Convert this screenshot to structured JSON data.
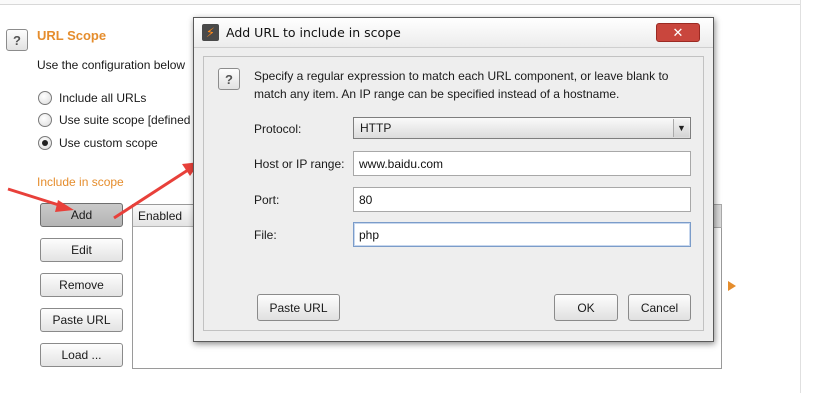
{
  "background": {
    "section_title": "URL Scope",
    "description": "Use the configuration below",
    "radio_options": [
      {
        "label": "Include all URLs",
        "checked": false
      },
      {
        "label": "Use suite scope [defined",
        "checked": false
      },
      {
        "label": "Use custom scope",
        "checked": true
      }
    ],
    "include_label": "Include in scope",
    "buttons": {
      "add": "Add",
      "edit": "Edit",
      "remove": "Remove",
      "paste_url": "Paste URL",
      "load": "Load ..."
    },
    "table": {
      "columns": [
        "Enabled"
      ]
    }
  },
  "dialog": {
    "title": "Add URL to include in scope",
    "close_glyph": "✕",
    "instruction": "Specify a regular expression to match each URL component, or leave blank to match any item. An IP range can be specified instead of a hostname.",
    "fields": {
      "protocol_label": "Protocol:",
      "protocol_value": "HTTP",
      "host_label": "Host or IP range:",
      "host_value": "www.baidu.com",
      "port_label": "Port:",
      "port_value": "80",
      "file_label": "File:",
      "file_value": "php"
    },
    "buttons": {
      "paste_url": "Paste URL",
      "ok": "OK",
      "cancel": "Cancel"
    }
  },
  "icons": {
    "help": "?",
    "app": "⚡",
    "dropdown": "▼"
  },
  "colors": {
    "accent_orange": "#e58d2d",
    "arrow_red": "#e8403a",
    "close_red": "#c9463d"
  }
}
